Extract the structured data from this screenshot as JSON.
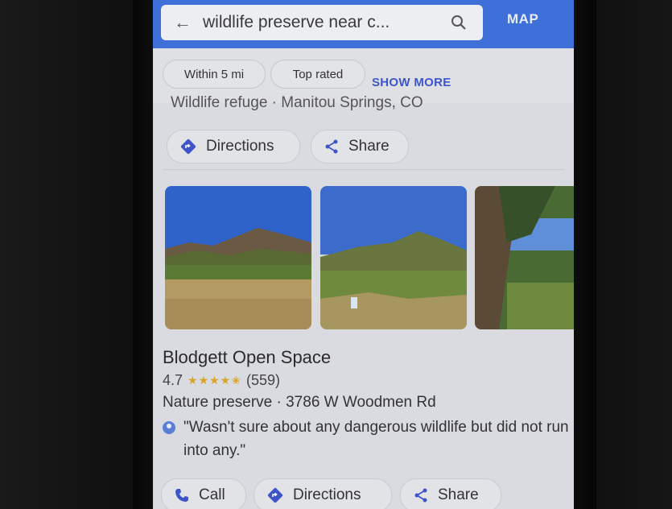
{
  "search": {
    "query": "wildlife preserve near c...",
    "map_label": "MAP"
  },
  "filters": {
    "chips": [
      "Within 5 mi",
      "Top rated"
    ],
    "show_more": "SHOW MORE"
  },
  "previous_result": {
    "subtitle_cut": "Wildlife refuge · Manitou Springs, CO",
    "actions": {
      "directions": "Directions",
      "share": "Share"
    }
  },
  "result": {
    "name": "Blodgett Open Space",
    "rating": "4.7",
    "stars": 4.5,
    "reviews": "(559)",
    "meta": "Nature preserve · 3786 W Woodmen Rd",
    "review_quote": "\"Wasn't sure about any dangerous wildlife but did not run into any.\"",
    "actions": {
      "call": "Call",
      "directions": "Directions",
      "share": "Share"
    }
  },
  "colors": {
    "header_blue": "#3f6fd8",
    "link_blue": "#3d55c8",
    "star_gold": "#d9a326"
  }
}
